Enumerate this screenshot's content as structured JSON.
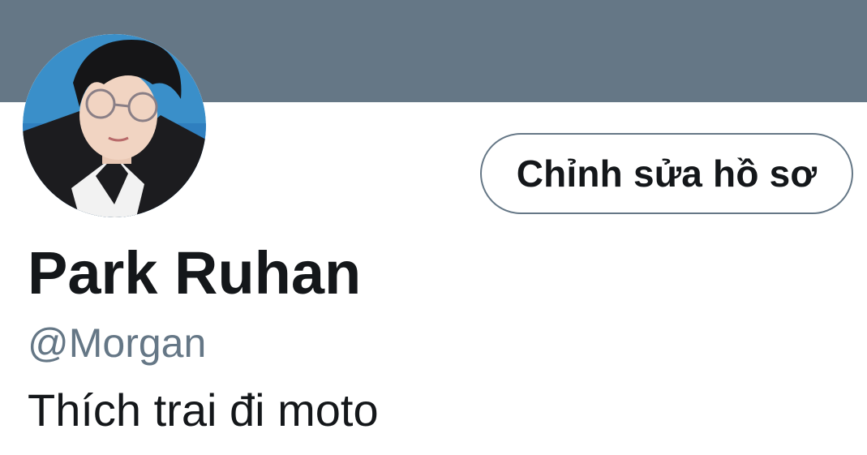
{
  "colors": {
    "banner": "#657786",
    "text_primary": "#14171a",
    "text_secondary": "#657786",
    "button_border": "#657786"
  },
  "profile": {
    "avatar_icon": "profile-photo",
    "display_name": "Park Ruhan",
    "handle": "@Morgan",
    "bio": "Thích trai đi moto"
  },
  "actions": {
    "edit_profile_label": "Chỉnh sửa hồ sơ"
  }
}
